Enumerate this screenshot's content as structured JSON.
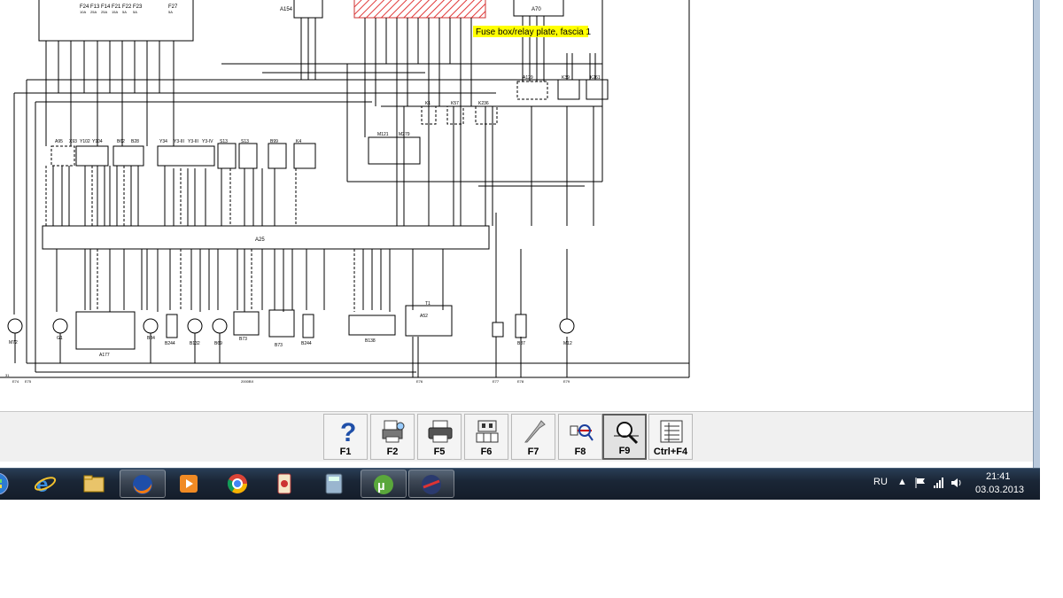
{
  "diagram": {
    "tooltip": "Fuse box/relay plate, fascia 1",
    "fuses": [
      "F24",
      "F13",
      "F14",
      "F21",
      "F22",
      "F23",
      "F27"
    ],
    "fuse_amps": [
      "10A",
      "25A",
      "25A",
      "15A",
      "5A",
      "5A",
      "5A"
    ],
    "top_components": [
      "A154",
      "A70"
    ],
    "relay_group": [
      "K1",
      "K57",
      "K236",
      "A129",
      "K39",
      "K261"
    ],
    "upper_modules": [
      "A95",
      "X93",
      "Y102",
      "Y104",
      "B62",
      "B28",
      "Y34",
      "Y3-III",
      "Y3-III",
      "Y3-IV",
      "S13",
      "S13",
      "B99",
      "K4",
      "M121",
      "M279"
    ],
    "central_unit": "A25",
    "lower_modules": [
      "M72",
      "G1",
      "A177",
      "B84",
      "B244",
      "B132",
      "B69",
      "B73",
      "B73",
      "B244",
      "B138",
      "T1",
      "A52",
      "B87",
      "M12"
    ],
    "ground_points": [
      "31",
      "E74",
      "E75",
      "E76",
      "E77",
      "E78",
      "E79"
    ],
    "bottom_note": "2000BX"
  },
  "toolbar": {
    "buttons": [
      {
        "key": "F1",
        "icon": "help-icon"
      },
      {
        "key": "F2",
        "icon": "print-preview-icon"
      },
      {
        "key": "F5",
        "icon": "printer-icon"
      },
      {
        "key": "F6",
        "icon": "connector-icon"
      },
      {
        "key": "F7",
        "icon": "wrench-icon"
      },
      {
        "key": "F8",
        "icon": "trace-icon"
      },
      {
        "key": "F9",
        "icon": "zoom-icon"
      },
      {
        "key": "Ctrl+F4",
        "icon": "list-icon"
      }
    ],
    "active": "F9"
  },
  "taskbar": {
    "apps": [
      "Start",
      "Internet Explorer",
      "Windows Explorer",
      "Firefox",
      "Media Player",
      "Chrome",
      "Solitaire",
      "Calculator",
      "uTorrent",
      "Autodata"
    ],
    "lang": "RU",
    "time": "21:41",
    "date": "03.03.2013"
  },
  "colors": {
    "tooltip_bg": "#ffff00",
    "fuse_block_hatch": "#e23a3a",
    "taskbar": "#1b2838",
    "toolbar_bg": "#f0f0f0"
  }
}
